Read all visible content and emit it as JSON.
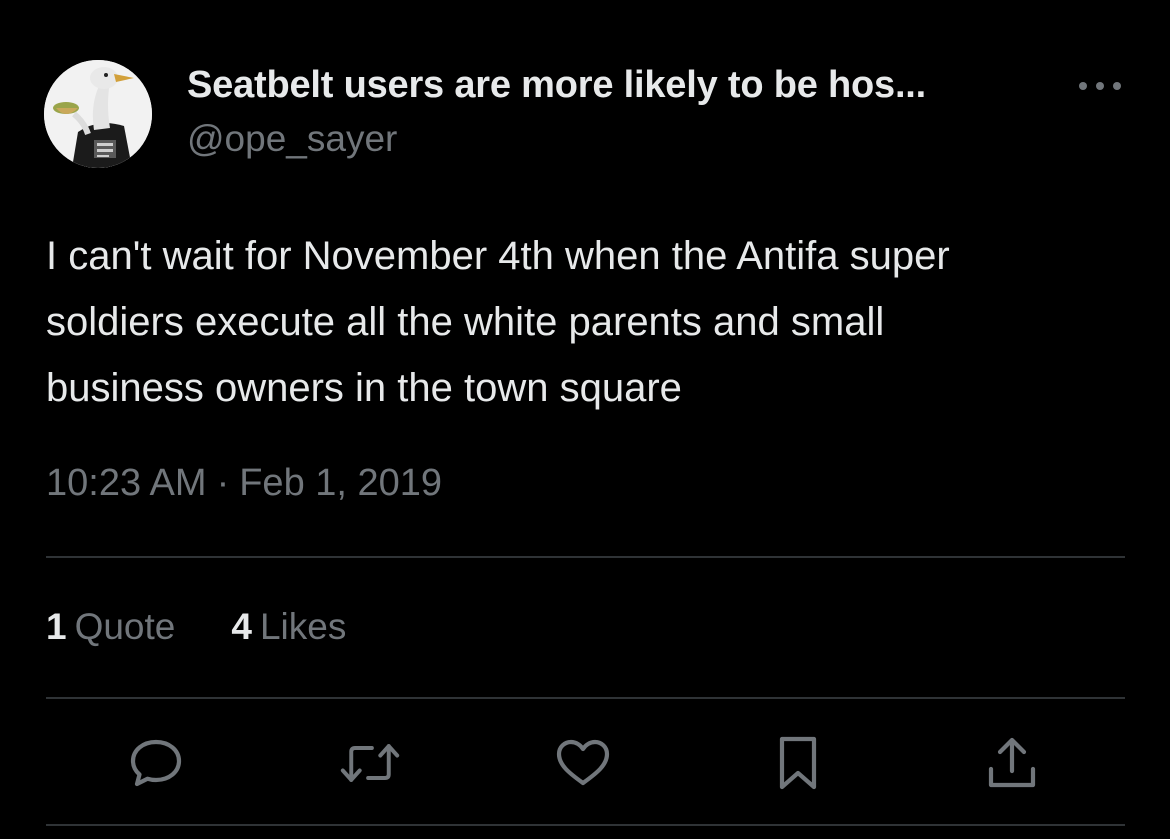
{
  "tweet": {
    "display_name": "Seatbelt users are more likely to be hos...",
    "handle": "@ope_sayer",
    "text": "I can't wait for November 4th when the Antifa super\nsoldiers execute all the white parents and small\nbusiness owners in the town square",
    "time": "10:23 AM",
    "separator": "·",
    "date": "Feb 1, 2019"
  },
  "stats": {
    "quotes_count": "1",
    "quotes_label": "Quote",
    "likes_count": "4",
    "likes_label": "Likes"
  },
  "icons": {
    "more": "more-horizontal-icon",
    "reply": "reply-icon",
    "retweet": "retweet-icon",
    "like": "heart-icon",
    "bookmark": "bookmark-icon",
    "share": "share-icon"
  },
  "colors": {
    "background": "#000000",
    "primary_text": "#e7e9ea",
    "secondary_text": "#71767b",
    "divider": "#2f3336"
  }
}
